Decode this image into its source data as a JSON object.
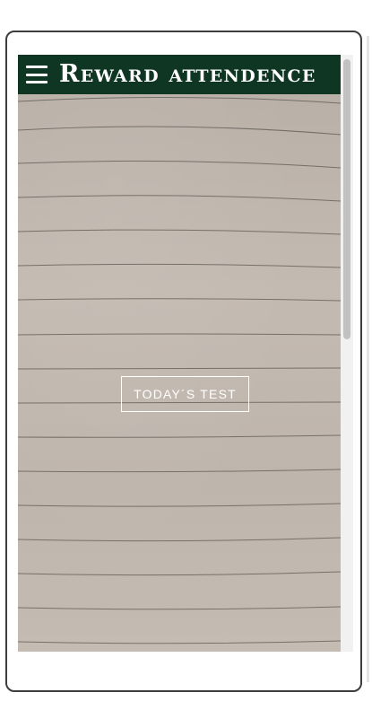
{
  "app_bar": {
    "title": "Reward attendence",
    "background_color": "#0e3622",
    "menu_icon": "hamburger-menu-icon"
  },
  "main": {
    "background": "lined-paper-photo",
    "test_button_label": "TODAY´S TEST"
  },
  "scrollbar": {
    "visible": true
  }
}
